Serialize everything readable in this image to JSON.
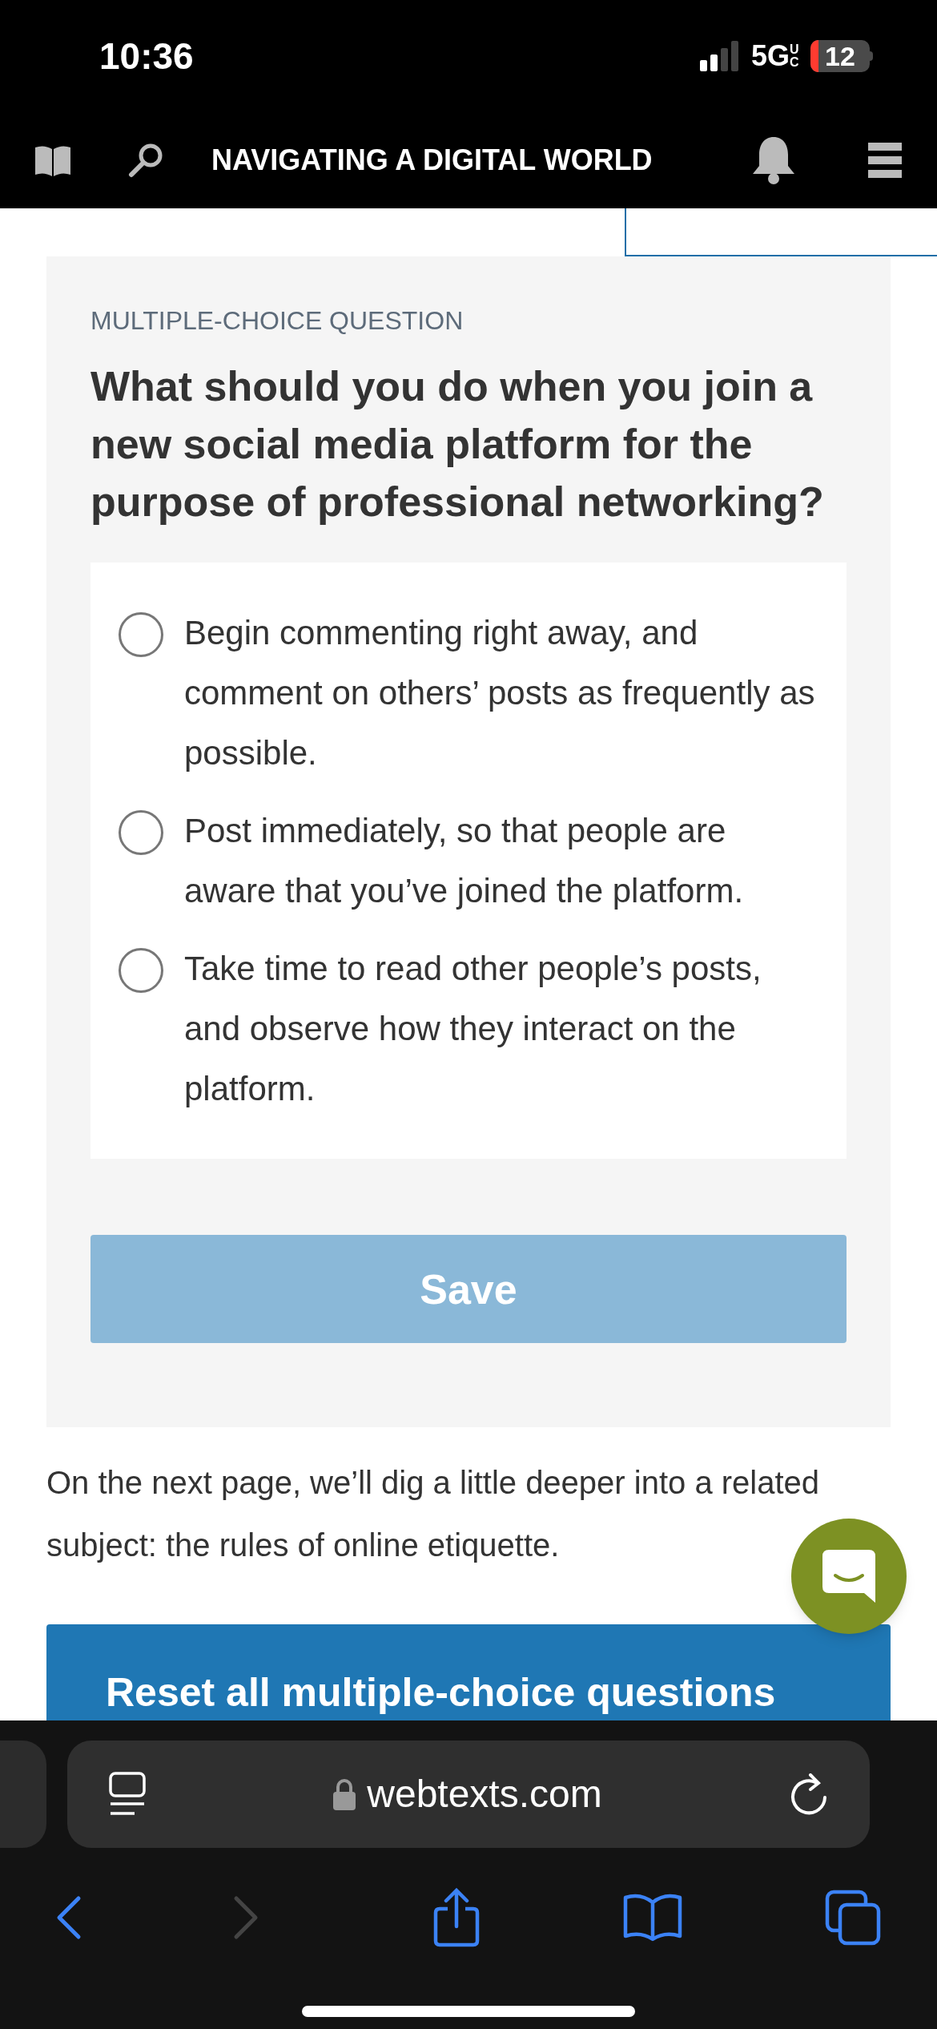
{
  "status_bar": {
    "time": "10:36",
    "network": "5G",
    "network_badge": "UC",
    "battery": "12"
  },
  "header": {
    "title": "NAVIGATING A DIGITAL WORLD"
  },
  "question": {
    "label": "MULTIPLE-CHOICE QUESTION",
    "text": "What should you do when you join a new social media platform for the purpose of professional networking?",
    "options": [
      {
        "text": "Begin commenting right away, and comment on others’ posts as frequently as possible.",
        "selected": false
      },
      {
        "text": "Post immediately, so that people are aware that you’ve joined the platform.",
        "selected": false
      },
      {
        "text": "Take time to read other people’s posts, and observe how they interact on the platform.",
        "selected": false
      }
    ],
    "save_button": {
      "label": "Save",
      "disabled": true
    }
  },
  "paragraph": "On the next page, we’ll dig a little deeper into a related subject: the rules of online etiquette.",
  "reset_button": {
    "label": "Reset all multiple-choice questions"
  },
  "browser": {
    "url": "webtexts.com",
    "back_disabled": false,
    "forward_disabled": true
  }
}
